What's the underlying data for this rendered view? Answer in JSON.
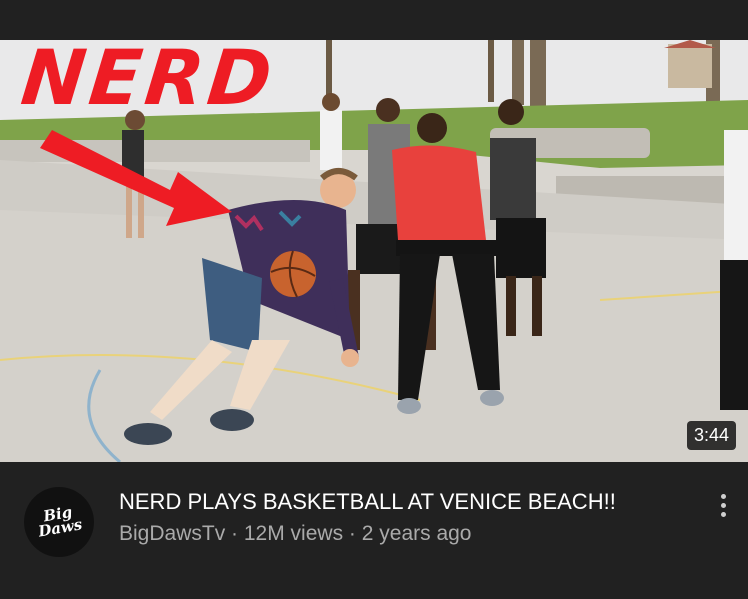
{
  "video": {
    "overlay_text": "NERD",
    "duration": "3:44",
    "title": "NERD PLAYS BASKETBALL AT VENICE BEACH!!",
    "channel": "BigDawsTv",
    "views": "12M views",
    "age": "2 years ago",
    "separator": " · "
  },
  "channel_avatar": {
    "text_line1": "Big",
    "text_line2": "Daws"
  },
  "icons": {
    "more": "more-vertical-icon",
    "arrow": "red-arrow-overlay"
  },
  "colors": {
    "accent_red": "#ee1c24",
    "background": "#212121",
    "secondary_text": "#aaaaaa"
  }
}
